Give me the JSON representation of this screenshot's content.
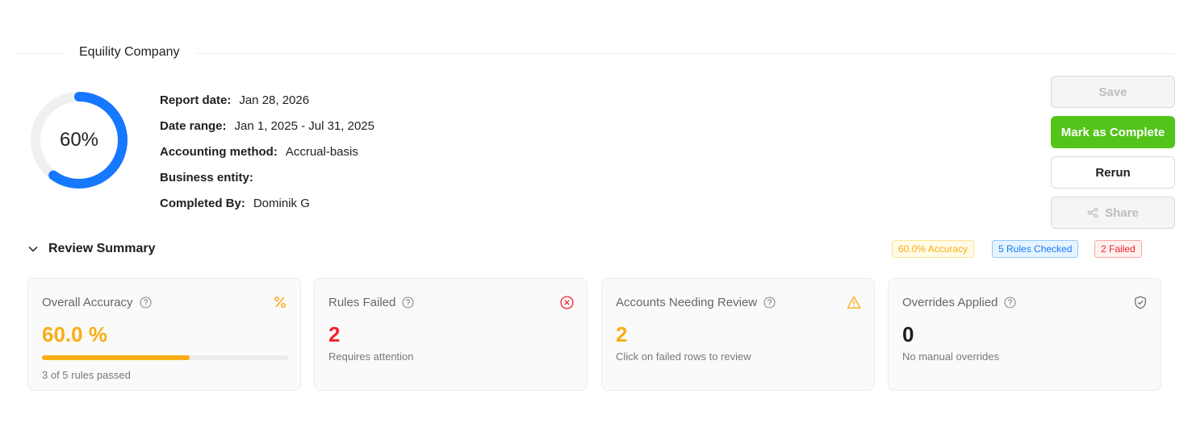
{
  "company": {
    "title": "Equility Company"
  },
  "progress": {
    "percent": 60,
    "label": "60%",
    "color": "#1677ff"
  },
  "details": {
    "report_date": {
      "label": "Report date:",
      "value": "Jan 28, 2026"
    },
    "date_range": {
      "label": "Date range:",
      "value": "Jan 1, 2025 - Jul 31, 2025"
    },
    "accounting_method": {
      "label": "Accounting method:",
      "value": "Accrual-basis"
    },
    "business_entity": {
      "label": "Business entity:",
      "value": ""
    },
    "completed_by": {
      "label": "Completed By:",
      "value": "Dominik G"
    }
  },
  "actions": {
    "save": "Save",
    "mark_complete": "Mark as Complete",
    "rerun": "Rerun",
    "share": "Share"
  },
  "review_summary": {
    "title": "Review Summary",
    "tags": {
      "accuracy": "60.0% Accuracy",
      "rules_checked": "5 Rules Checked",
      "failed": "2 Failed"
    },
    "cards": {
      "accuracy": {
        "title": "Overall Accuracy",
        "value": "60.0 %",
        "progress": 0.6,
        "sub": "3 of 5 rules passed",
        "icon": "percent-icon",
        "color": "#faad14"
      },
      "rules_failed": {
        "title": "Rules Failed",
        "value": "2",
        "sub": "Requires attention",
        "icon": "close-circle-icon",
        "color": "#f5222d"
      },
      "accounts_review": {
        "title": "Accounts Needing Review",
        "value": "2",
        "sub": "Click on failed rows to review",
        "icon": "warning-icon",
        "color": "#faad14"
      },
      "overrides": {
        "title": "Overrides Applied",
        "value": "0",
        "sub": "No manual overrides",
        "icon": "shield-check-icon",
        "color": "#1f1f1f"
      }
    }
  }
}
